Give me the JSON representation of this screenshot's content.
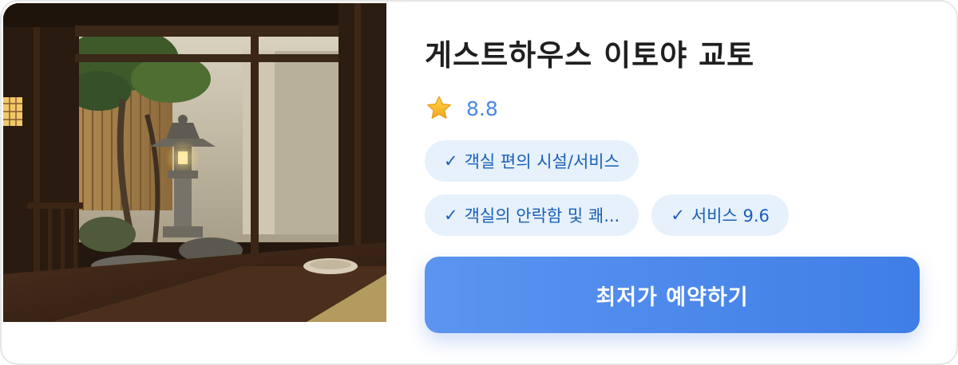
{
  "hotel": {
    "name": "게스트하우스 이토야 교토",
    "rating": "8.8",
    "tags_row1": [
      {
        "check": "✓",
        "label": "객실 편의 시설/서비스"
      }
    ],
    "tags_row2": [
      {
        "check": "✓",
        "label": "객실의 안락함 및 쾌..."
      },
      {
        "check": "✓",
        "label": "서비스 9.6"
      }
    ]
  },
  "action": {
    "book_label": "최저가 예약하기"
  },
  "icons": {
    "rating": "star-icon"
  },
  "colors": {
    "accent": "#4a88ea",
    "tag_bg": "#e6f1fc",
    "tag_text": "#1b5fb8",
    "button_start": "#5b95f0",
    "button_end": "#3f7ee6",
    "star": "#f5b921"
  }
}
